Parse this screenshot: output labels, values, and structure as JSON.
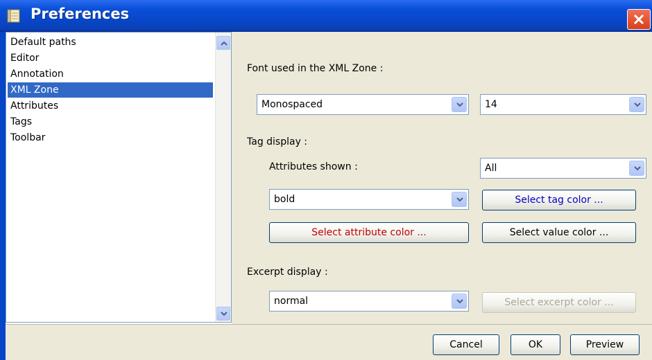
{
  "window": {
    "title": "Preferences"
  },
  "sidebar": {
    "items": [
      {
        "label": "Default paths"
      },
      {
        "label": "Editor"
      },
      {
        "label": "Annotation"
      },
      {
        "label": "XML Zone",
        "selected": true
      },
      {
        "label": "Attributes"
      },
      {
        "label": "Tags"
      },
      {
        "label": "Toolbar"
      }
    ]
  },
  "main": {
    "font_section_label": "Font used in the XML Zone :",
    "font_family": "Monospaced",
    "font_size": "14",
    "tag_display_label": "Tag display :",
    "attributes_shown_label": "Attributes shown :",
    "attributes_shown_value": "All",
    "tag_style_value": "bold",
    "select_tag_color": "Select tag color ...",
    "select_attribute_color": "Select attribute color ...",
    "select_value_color": "Select value color ...",
    "excerpt_display_label": "Excerpt display :",
    "excerpt_style_value": "normal",
    "select_excerpt_color": "Select excerpt color ..."
  },
  "footer": {
    "cancel_label": "Cancel",
    "ok_label": "OK",
    "preview_label": "Preview"
  },
  "colors": {
    "title_bar": "#0a4fd8",
    "selection": "#3169c6",
    "tag_color_text": "#0000c0",
    "attribute_color_text": "#c00000",
    "value_color_text": "#000000"
  }
}
